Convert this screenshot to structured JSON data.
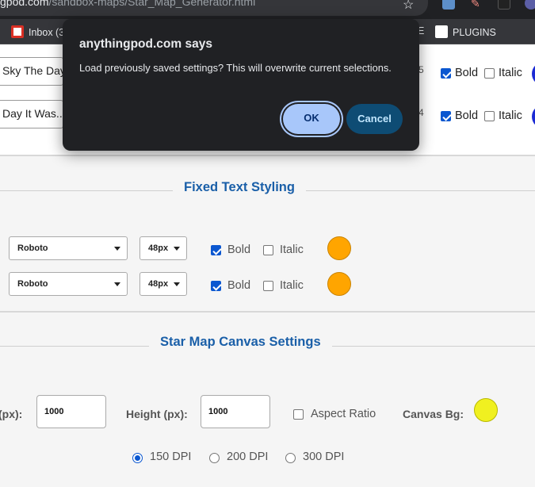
{
  "browser": {
    "url_host": "gpod.com",
    "url_path": "/sandbox-maps/Star_Map_Generator.html",
    "bookmarks": [
      {
        "label": "Inbox (3"
      },
      {
        "label": "E"
      },
      {
        "label": "PLUGINS"
      }
    ]
  },
  "top_rows": [
    {
      "text": "Sky The Day I",
      "side_digit": "5",
      "bold_checked": true,
      "italic_checked": false,
      "bold_label": "Bold",
      "italic_label": "Italic"
    },
    {
      "text": "Day It Was...",
      "side_digit": "4",
      "bold_checked": true,
      "italic_checked": false,
      "bold_label": "Bold",
      "italic_label": "Italic"
    }
  ],
  "fixed_text": {
    "title": "Fixed Text Styling",
    "rows": [
      {
        "font": "Roboto",
        "size": "48px",
        "bold_label": "Bold",
        "italic_label": "Italic",
        "bold_checked": true,
        "italic_checked": false,
        "color": "#ffa500"
      },
      {
        "font": "Roboto",
        "size": "48px",
        "bold_label": "Bold",
        "italic_label": "Italic",
        "bold_checked": true,
        "italic_checked": false,
        "color": "#ffa500"
      }
    ]
  },
  "canvas": {
    "title": "Star Map Canvas Settings",
    "width_label": "(px):",
    "width_value": "1000",
    "height_label": "Height (px):",
    "height_value": "1000",
    "aspect_label": "Aspect Ratio",
    "aspect_checked": false,
    "bg_label": "Canvas Bg:",
    "bg_color": "#f0f020",
    "dpi_options": [
      {
        "label": "150 DPI",
        "checked": true
      },
      {
        "label": "200 DPI",
        "checked": false
      },
      {
        "label": "300 DPI",
        "checked": false
      }
    ]
  },
  "dialog": {
    "title": "anythingpod.com says",
    "message": "Load previously saved settings? This will overwrite current selections.",
    "ok_label": "OK",
    "cancel_label": "Cancel"
  }
}
